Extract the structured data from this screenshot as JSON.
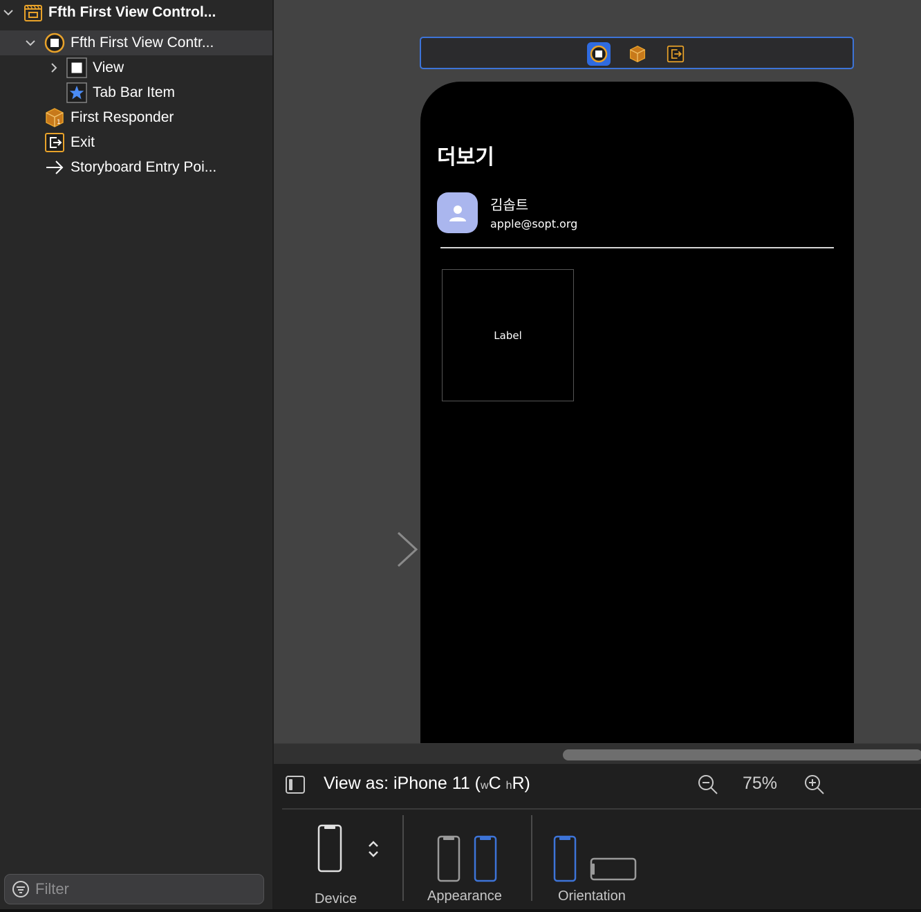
{
  "outline": {
    "items": [
      {
        "label": "Ffth First View Control...",
        "icon": "scene-icon",
        "disclosure": "chevron-down-icon"
      },
      {
        "label": "Ffth First View Contr...",
        "icon": "view-controller-icon",
        "disclosure": "chevron-down-icon"
      },
      {
        "label": "View",
        "icon": "view-icon",
        "disclosure": "chevron-right-icon"
      },
      {
        "label": "Tab Bar Item",
        "icon": "star-icon"
      },
      {
        "label": "First Responder",
        "icon": "first-responder-icon"
      },
      {
        "label": "Exit",
        "icon": "exit-icon"
      },
      {
        "label": "Storyboard Entry Poi...",
        "icon": "arrow-right-icon"
      }
    ],
    "filter_placeholder": "Filter"
  },
  "canvas": {
    "scene_bar_icons": [
      "view-controller-icon",
      "first-responder-icon",
      "exit-icon"
    ],
    "screen": {
      "title": "더보기",
      "profile_name": "김솝트",
      "profile_email": "apple@sopt.org",
      "label": "Label"
    }
  },
  "bottom_bar": {
    "view_as_prefix": "View as: iPhone 11 (",
    "size_w": "w",
    "size_w_val": "C",
    "size_h": "h",
    "size_h_val": "R)",
    "zoom": "75%",
    "device_label": "Device",
    "appearance_label": "Appearance",
    "orientation_label": "Orientation"
  },
  "colors": {
    "accent": "#3d74d8",
    "icon_orange": "#e8a22a",
    "avatar": "#aab6ee"
  }
}
